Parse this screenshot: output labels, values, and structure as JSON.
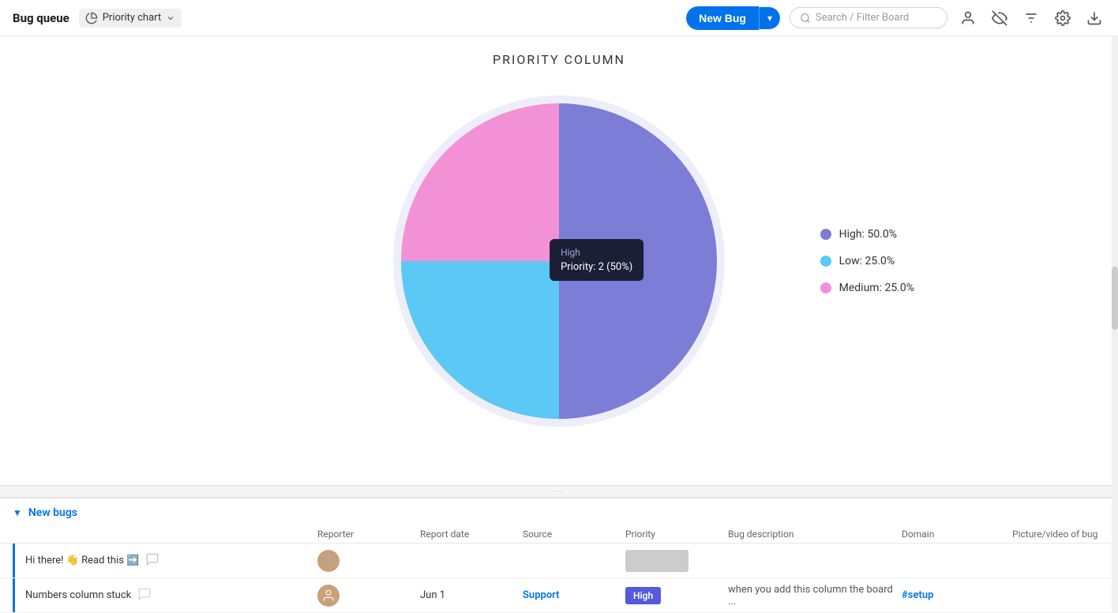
{
  "header": {
    "title": "Bug queue",
    "chart_tab_label": "Priority chart",
    "new_bug_label": "New Bug",
    "search_placeholder": "Search / Filter Board"
  },
  "chart": {
    "title": "PRIORITY COLUMN",
    "segments": [
      {
        "label": "High",
        "percent": 50,
        "color": "#7b7dd6",
        "startAngle": 0,
        "endAngle": 180
      },
      {
        "label": "Low",
        "percent": 25,
        "color": "#5bc8f5",
        "startAngle": 180,
        "endAngle": 270
      },
      {
        "label": "Medium",
        "percent": 25,
        "color": "#f391d6",
        "startAngle": 270,
        "endAngle": 360
      }
    ],
    "tooltip": {
      "label": "High",
      "value": "Priority: 2 (50%)"
    },
    "legend": [
      {
        "label": "High: 50.0%",
        "color": "#7b7dd6"
      },
      {
        "label": "Low: 25.0%",
        "color": "#5bc8f5"
      },
      {
        "label": "Medium: 25.0%",
        "color": "#f391d6"
      }
    ]
  },
  "table": {
    "section_label": "New bugs",
    "columns": [
      "Reporter",
      "Report date",
      "Source",
      "Priority",
      "Bug description",
      "Domain",
      "Picture/video of bug"
    ],
    "rows": [
      {
        "name": "Hi there! 👋 Read this ➡️",
        "reporter": "",
        "report_date": "",
        "source": "",
        "priority": "",
        "bug_description": "",
        "domain": "",
        "picture": "",
        "has_avatar": false,
        "priority_type": "empty"
      },
      {
        "name": "Numbers column stuck",
        "reporter": "",
        "report_date": "Jun 1",
        "source": "Support",
        "priority": "High",
        "bug_description": "when you add this column the board ...",
        "domain": "#setup",
        "picture": "",
        "has_avatar": true,
        "priority_type": "high"
      }
    ]
  },
  "resize_handle": "···"
}
